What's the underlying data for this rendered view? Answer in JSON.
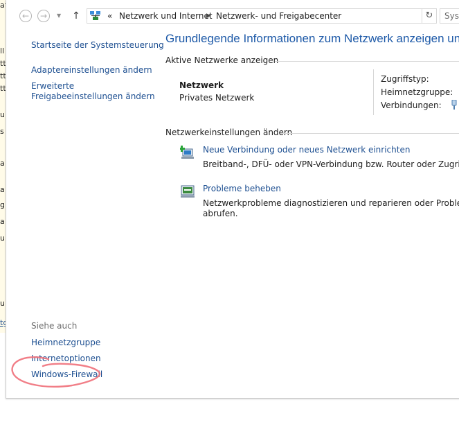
{
  "background_window": {
    "fragments": [
      "af",
      "ll",
      "tt",
      "tt",
      "tt",
      "u",
      "s",
      "a",
      "a",
      "g",
      "a",
      "u",
      "u",
      "tg"
    ]
  },
  "toolbar": {
    "breadcrumb_prefix": "«",
    "breadcrumbs": [
      "Netzwerk und Internet",
      "Netzwerk- und Freigabecenter"
    ],
    "search_placeholder": "Sys"
  },
  "sidebar": {
    "items": [
      {
        "label": "Startseite der Systemsteuerung"
      },
      {
        "label": "Adaptereinstellungen ändern"
      },
      {
        "label": "Erweiterte\nFreigabeeinstellungen ändern",
        "line1": "Erweiterte",
        "line2": "Freigabeeinstellungen ändern"
      }
    ],
    "see_also_label": "Siehe auch",
    "see_also": [
      {
        "label": "Heimnetzgruppe"
      },
      {
        "label": "Internetoptionen"
      },
      {
        "label": "Windows-Firewall"
      }
    ]
  },
  "main": {
    "title": "Grundlegende Informationen zum Netzwerk anzeigen und Ve",
    "active_networks_header": "Aktive Netzwerke anzeigen",
    "network": {
      "name": "Netzwerk",
      "category": "Privates Netzwerk",
      "props": [
        "Zugriffstyp:",
        "Heimnetzgruppe:",
        "Verbindungen:"
      ]
    },
    "settings_header": "Netzwerkeinstellungen ändern",
    "tasks": [
      {
        "link": "Neue Verbindung oder neues Netzwerk einrichten",
        "desc_line1": "Breitband-, DFÜ- oder VPN-Verbindung bzw. Router oder Zugriffspunk",
        "desc_line2": ""
      },
      {
        "link": "Probleme beheben",
        "desc_line1": "Netzwerkprobleme diagnostizieren und reparieren oder Problembehan",
        "desc_line2": "abrufen."
      }
    ]
  },
  "colors": {
    "link": "#1d4f91",
    "title": "#1e5aa8",
    "annotation": "#f0707a"
  }
}
